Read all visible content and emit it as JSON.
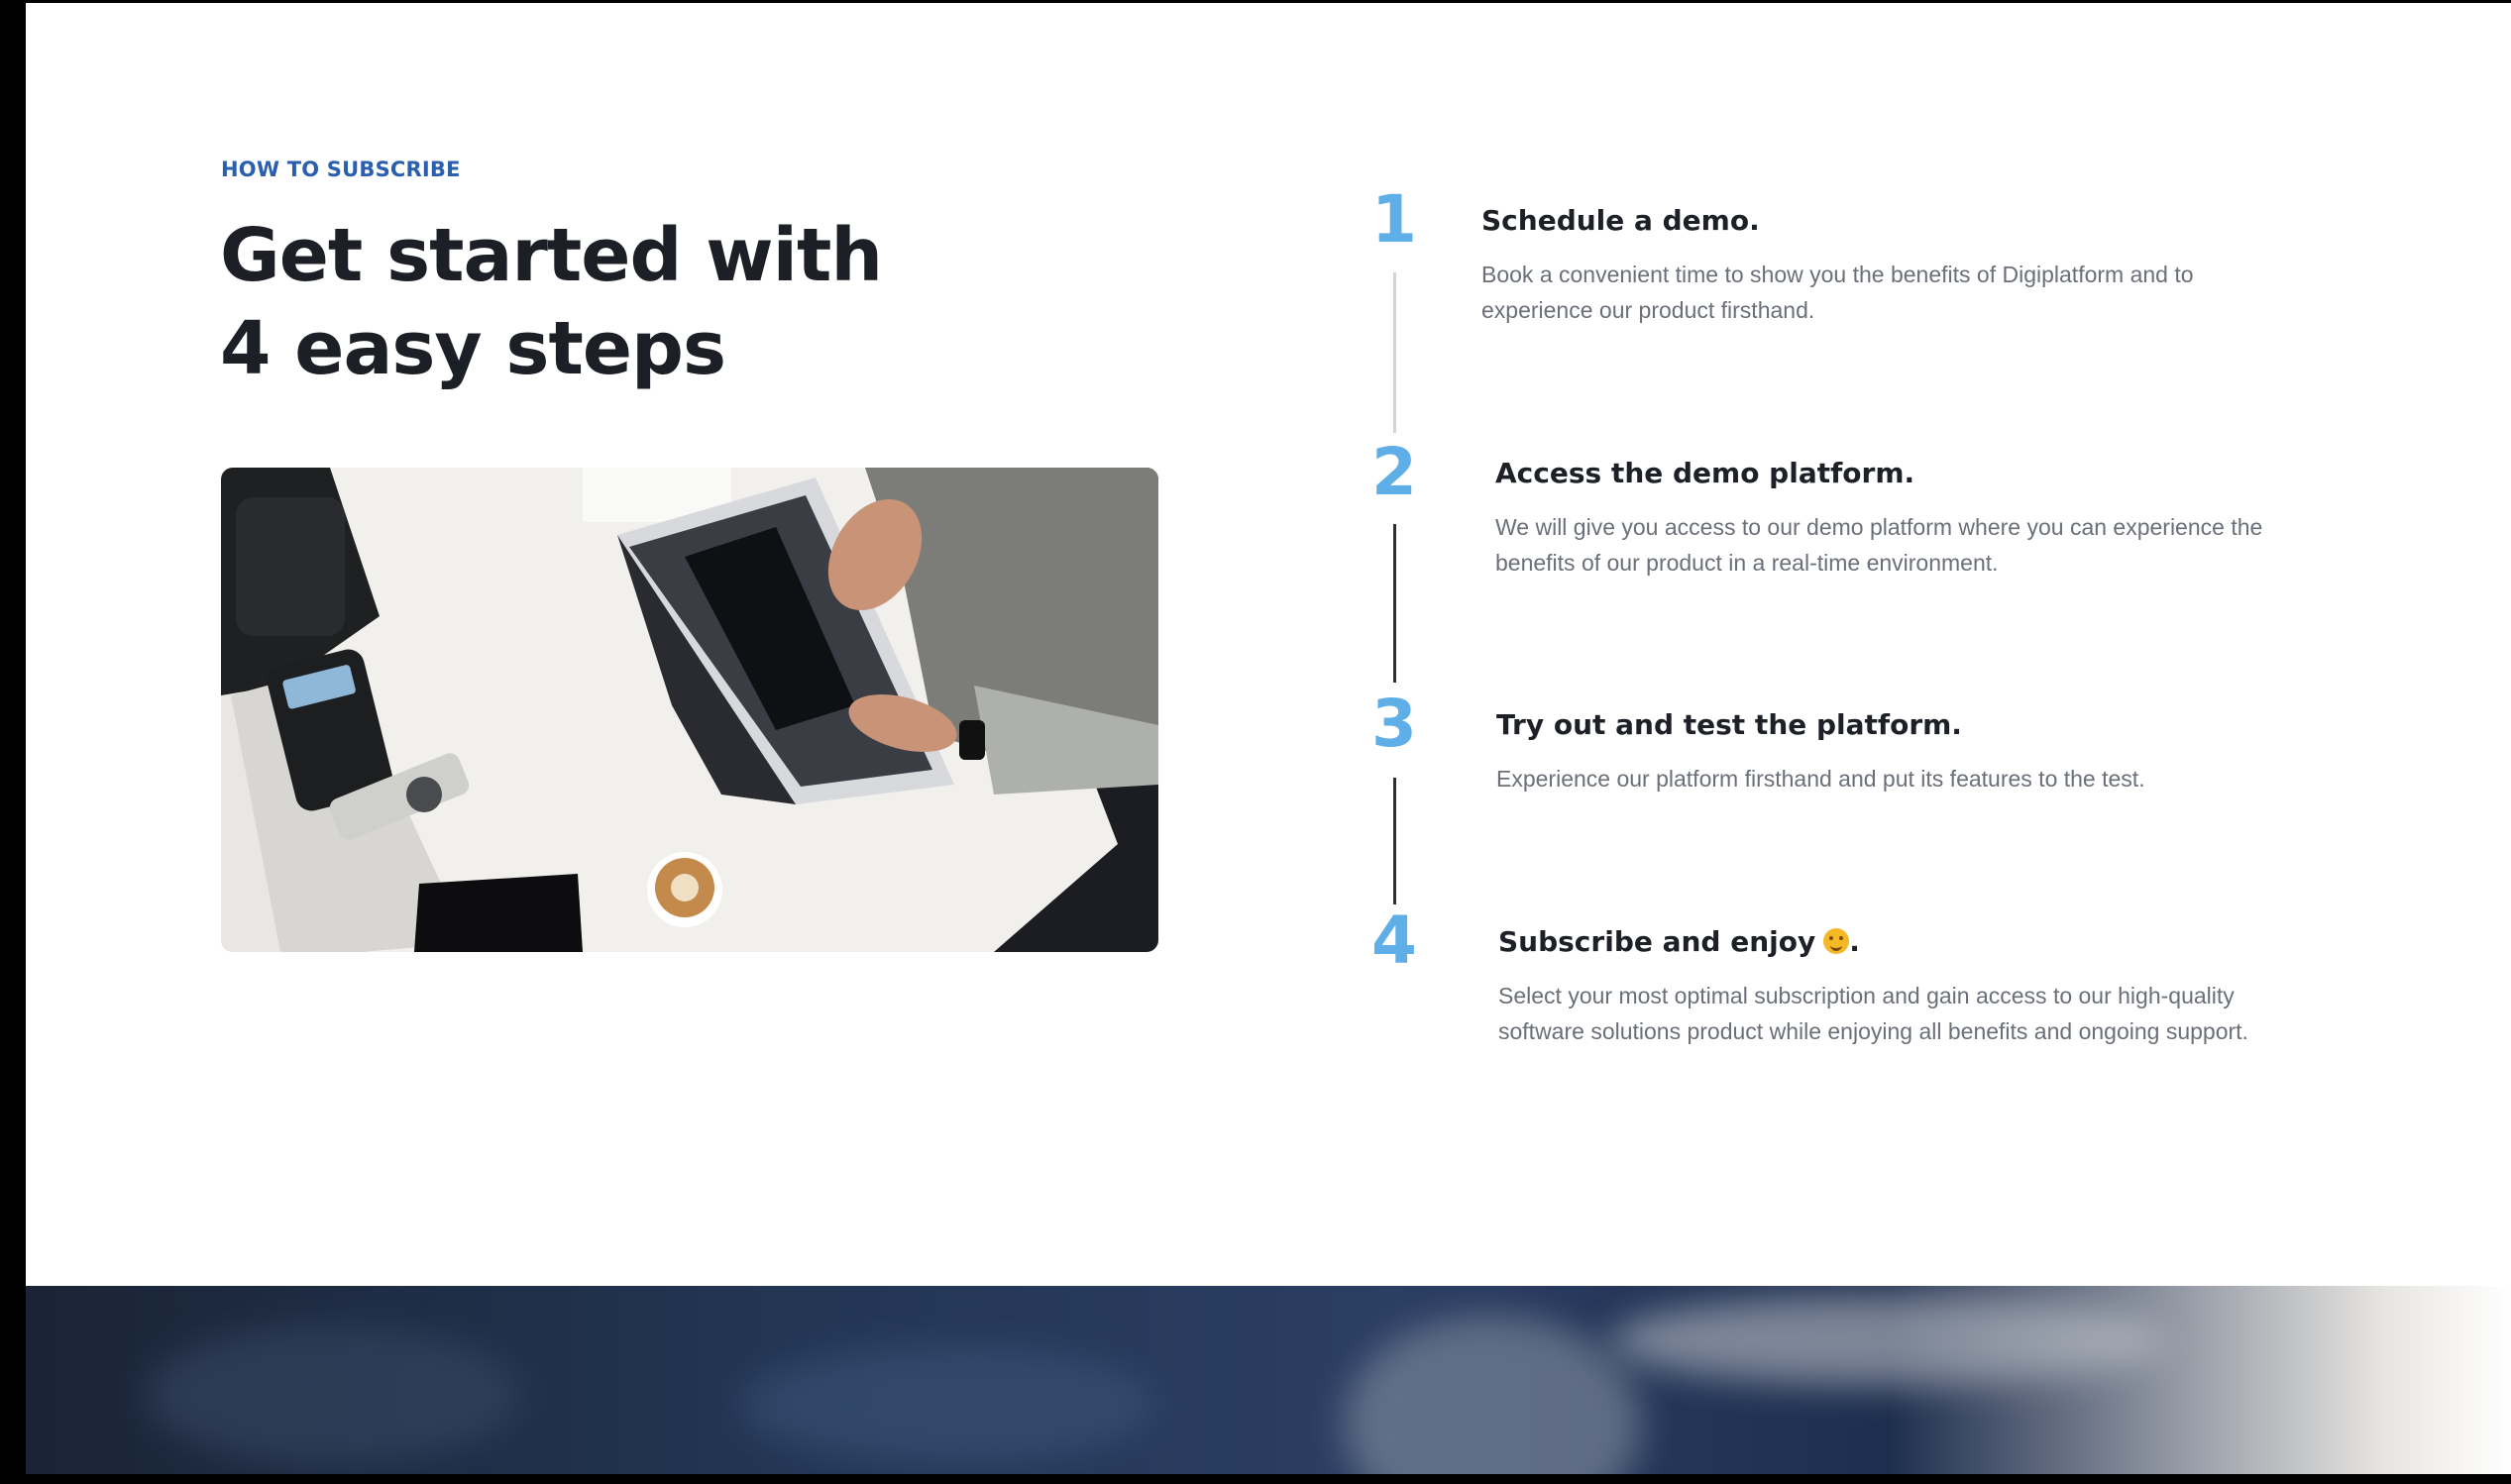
{
  "section": {
    "eyebrow": "HOW TO SUBSCRIBE",
    "headline_line1": "Get started with",
    "headline_line2": "4 easy steps"
  },
  "steps": [
    {
      "number": "1",
      "title": "Schedule a demo.",
      "description": "Book a convenient time to show you the benefits of Digiplatform and to experience our product firsthand."
    },
    {
      "number": "2",
      "title": "Access the demo platform.",
      "description": "We will give you access to our demo platform where you can experience the benefits of our product in a real-time environment."
    },
    {
      "number": "3",
      "title": "Try out and test the platform.",
      "description": "Experience our platform firsthand and put its features to the test."
    },
    {
      "number": "4",
      "title": "Subscribe and enjoy",
      "title_suffix": ".",
      "description": "Select your most optimal subscription and gain access to our high-quality software solutions product while enjoying all benefits and ongoing support."
    }
  ],
  "icons": {
    "emoji": "smiling-face-emoji-icon"
  },
  "colors": {
    "accent_blue": "#5eaee8",
    "eyebrow_blue": "#2a5fb0",
    "heading": "#1c1f25",
    "body_text": "#6a6f78"
  }
}
